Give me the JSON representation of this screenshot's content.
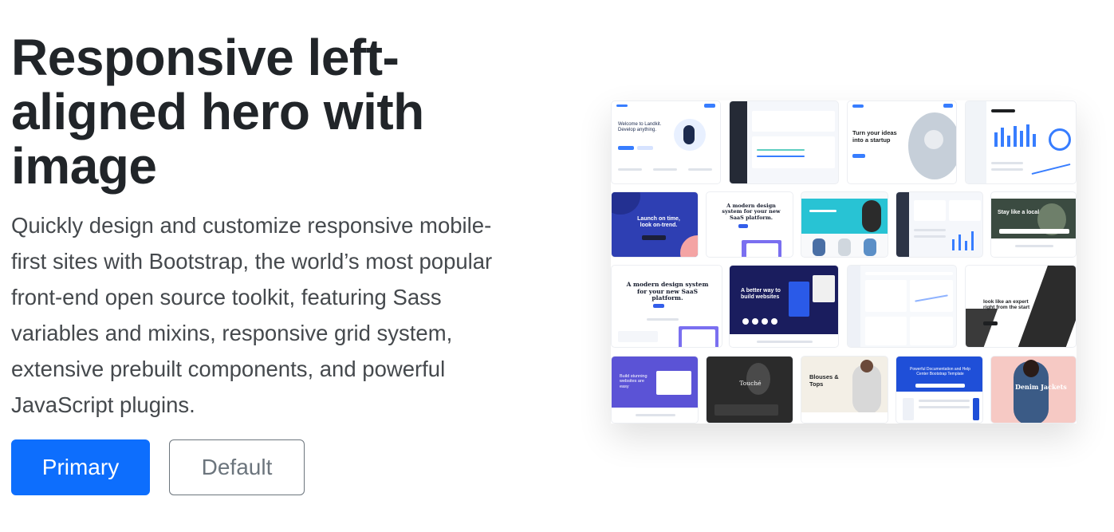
{
  "hero": {
    "title": "Responsive left-aligned hero with image",
    "lead": "Quickly design and customize responsive mobile-first sites with Bootstrap, the world’s most popular front-end open source toolkit, featuring Sass variables and mixins, responsive grid system, extensive prebuilt components, and powerful JavaScript plugins."
  },
  "buttons": {
    "primary": "Primary",
    "default": "Default"
  },
  "collage": {
    "thumbnails": [
      {
        "headline": "Welcome to Landkit. Develop anything."
      },
      {
        "headline": ""
      },
      {
        "headline": "Turn your ideas into a startup"
      },
      {
        "headline": ""
      },
      {
        "headline": "Launch on time, look on-trend."
      },
      {
        "headline": "A modern design system for your new SaaS platform."
      },
      {
        "headline": ""
      },
      {
        "headline": ""
      },
      {
        "headline": "Stay like a local"
      },
      {
        "headline": "A modern design system for your new SaaS platform."
      },
      {
        "headline": "A better way to build websites"
      },
      {
        "headline": ""
      },
      {
        "headline": "look like an expert right from the start"
      },
      {
        "headline": "Build stunning websites are easy"
      },
      {
        "headline": "Touché"
      },
      {
        "headline": "Blouses & Tops"
      },
      {
        "headline": "Powerful Documentation and Help Center Bootstrap Template"
      },
      {
        "headline": "Denim Jackets"
      }
    ]
  },
  "colors": {
    "primary": "#0d6efd",
    "secondary": "#6c757d",
    "heading": "#212529",
    "lead": "#45494d"
  }
}
